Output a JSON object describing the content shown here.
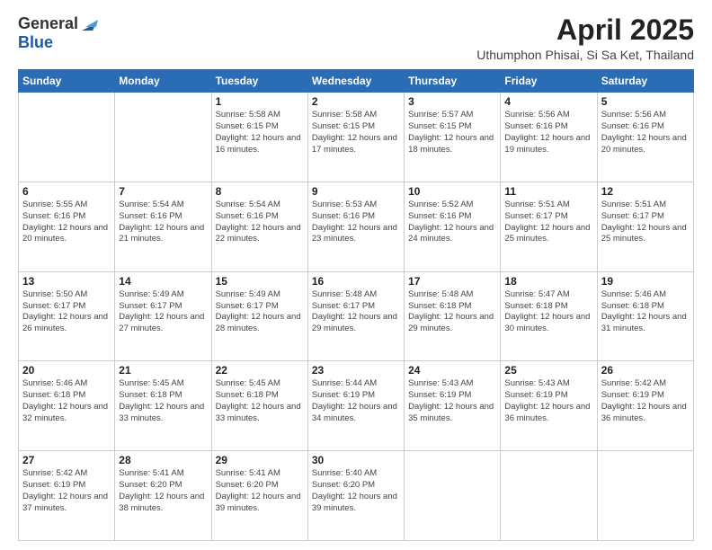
{
  "header": {
    "logo_general": "General",
    "logo_blue": "Blue",
    "month_title": "April 2025",
    "location": "Uthumphon Phisai, Si Sa Ket, Thailand"
  },
  "days_of_week": [
    "Sunday",
    "Monday",
    "Tuesday",
    "Wednesday",
    "Thursday",
    "Friday",
    "Saturday"
  ],
  "weeks": [
    [
      {
        "day": "",
        "info": ""
      },
      {
        "day": "",
        "info": ""
      },
      {
        "day": "1",
        "info": "Sunrise: 5:58 AM\nSunset: 6:15 PM\nDaylight: 12 hours and 16 minutes."
      },
      {
        "day": "2",
        "info": "Sunrise: 5:58 AM\nSunset: 6:15 PM\nDaylight: 12 hours and 17 minutes."
      },
      {
        "day": "3",
        "info": "Sunrise: 5:57 AM\nSunset: 6:15 PM\nDaylight: 12 hours and 18 minutes."
      },
      {
        "day": "4",
        "info": "Sunrise: 5:56 AM\nSunset: 6:16 PM\nDaylight: 12 hours and 19 minutes."
      },
      {
        "day": "5",
        "info": "Sunrise: 5:56 AM\nSunset: 6:16 PM\nDaylight: 12 hours and 20 minutes."
      }
    ],
    [
      {
        "day": "6",
        "info": "Sunrise: 5:55 AM\nSunset: 6:16 PM\nDaylight: 12 hours and 20 minutes."
      },
      {
        "day": "7",
        "info": "Sunrise: 5:54 AM\nSunset: 6:16 PM\nDaylight: 12 hours and 21 minutes."
      },
      {
        "day": "8",
        "info": "Sunrise: 5:54 AM\nSunset: 6:16 PM\nDaylight: 12 hours and 22 minutes."
      },
      {
        "day": "9",
        "info": "Sunrise: 5:53 AM\nSunset: 6:16 PM\nDaylight: 12 hours and 23 minutes."
      },
      {
        "day": "10",
        "info": "Sunrise: 5:52 AM\nSunset: 6:16 PM\nDaylight: 12 hours and 24 minutes."
      },
      {
        "day": "11",
        "info": "Sunrise: 5:51 AM\nSunset: 6:17 PM\nDaylight: 12 hours and 25 minutes."
      },
      {
        "day": "12",
        "info": "Sunrise: 5:51 AM\nSunset: 6:17 PM\nDaylight: 12 hours and 25 minutes."
      }
    ],
    [
      {
        "day": "13",
        "info": "Sunrise: 5:50 AM\nSunset: 6:17 PM\nDaylight: 12 hours and 26 minutes."
      },
      {
        "day": "14",
        "info": "Sunrise: 5:49 AM\nSunset: 6:17 PM\nDaylight: 12 hours and 27 minutes."
      },
      {
        "day": "15",
        "info": "Sunrise: 5:49 AM\nSunset: 6:17 PM\nDaylight: 12 hours and 28 minutes."
      },
      {
        "day": "16",
        "info": "Sunrise: 5:48 AM\nSunset: 6:17 PM\nDaylight: 12 hours and 29 minutes."
      },
      {
        "day": "17",
        "info": "Sunrise: 5:48 AM\nSunset: 6:18 PM\nDaylight: 12 hours and 29 minutes."
      },
      {
        "day": "18",
        "info": "Sunrise: 5:47 AM\nSunset: 6:18 PM\nDaylight: 12 hours and 30 minutes."
      },
      {
        "day": "19",
        "info": "Sunrise: 5:46 AM\nSunset: 6:18 PM\nDaylight: 12 hours and 31 minutes."
      }
    ],
    [
      {
        "day": "20",
        "info": "Sunrise: 5:46 AM\nSunset: 6:18 PM\nDaylight: 12 hours and 32 minutes."
      },
      {
        "day": "21",
        "info": "Sunrise: 5:45 AM\nSunset: 6:18 PM\nDaylight: 12 hours and 33 minutes."
      },
      {
        "day": "22",
        "info": "Sunrise: 5:45 AM\nSunset: 6:18 PM\nDaylight: 12 hours and 33 minutes."
      },
      {
        "day": "23",
        "info": "Sunrise: 5:44 AM\nSunset: 6:19 PM\nDaylight: 12 hours and 34 minutes."
      },
      {
        "day": "24",
        "info": "Sunrise: 5:43 AM\nSunset: 6:19 PM\nDaylight: 12 hours and 35 minutes."
      },
      {
        "day": "25",
        "info": "Sunrise: 5:43 AM\nSunset: 6:19 PM\nDaylight: 12 hours and 36 minutes."
      },
      {
        "day": "26",
        "info": "Sunrise: 5:42 AM\nSunset: 6:19 PM\nDaylight: 12 hours and 36 minutes."
      }
    ],
    [
      {
        "day": "27",
        "info": "Sunrise: 5:42 AM\nSunset: 6:19 PM\nDaylight: 12 hours and 37 minutes."
      },
      {
        "day": "28",
        "info": "Sunrise: 5:41 AM\nSunset: 6:20 PM\nDaylight: 12 hours and 38 minutes."
      },
      {
        "day": "29",
        "info": "Sunrise: 5:41 AM\nSunset: 6:20 PM\nDaylight: 12 hours and 39 minutes."
      },
      {
        "day": "30",
        "info": "Sunrise: 5:40 AM\nSunset: 6:20 PM\nDaylight: 12 hours and 39 minutes."
      },
      {
        "day": "",
        "info": ""
      },
      {
        "day": "",
        "info": ""
      },
      {
        "day": "",
        "info": ""
      }
    ]
  ]
}
